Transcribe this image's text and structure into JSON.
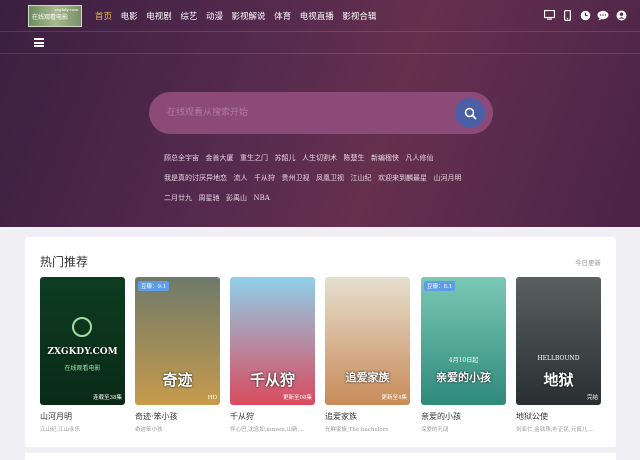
{
  "logo": {
    "text": "在线观看电影",
    "small": "zxgkdy.com"
  },
  "nav": [
    {
      "label": "首页",
      "active": true
    },
    {
      "label": "电影"
    },
    {
      "label": "电视剧"
    },
    {
      "label": "综艺"
    },
    {
      "label": "动漫"
    },
    {
      "label": "影视解说"
    },
    {
      "label": "体育"
    },
    {
      "label": "电视直播"
    },
    {
      "label": "影视合辑"
    }
  ],
  "top_icons": [
    "desktop-icon",
    "mobile-icon",
    "history-icon",
    "chat-icon",
    "user-icon"
  ],
  "search": {
    "placeholder": "在线观看从搜索开始"
  },
  "hot_tags": [
    "顾总全宇宙",
    "金善大厦",
    "重生之门",
    "苏韶儿",
    "人生切割术",
    "陈楚生",
    "新编楹侠",
    "凡人修仙",
    "我是真的讨厌异地恋",
    "流人",
    "千从狩",
    "贵州卫视",
    "凤凰卫视",
    "江山纪",
    "欢迎来到麟最星",
    "山河月明",
    "二月廿九",
    "周星驰",
    "彭禹山",
    "NBA"
  ],
  "section": {
    "title": "热门推荐",
    "more": "今日更新",
    "cards": [
      {
        "title": "山河月明",
        "sub": "江山纪,江山永乐",
        "badge": "",
        "note": "连载至38集",
        "colors": [
          "#0d3d20",
          "#0a2a18"
        ],
        "poster_text": "ZXGKDY.COM",
        "poster_sub": "在线观看电影"
      },
      {
        "title": "奇迹·笨小孩",
        "sub": "奇迹笨小孩",
        "badge": "豆瓣：9.1",
        "note": "HD",
        "colors": [
          "#6e7a6a",
          "#c79b4c"
        ],
        "poster_text": "奇迹",
        "poster_sub": ""
      },
      {
        "title": "千从狩",
        "sub": "怦心巴,沈念如,kinsen,山新,...",
        "badge": "",
        "note": "更新至08集",
        "colors": [
          "#8fd0ea",
          "#d94a5e"
        ],
        "poster_text": "千从狩",
        "poster_sub": ""
      },
      {
        "title": "追爱家族",
        "sub": "光鲜家族,The bachelors",
        "badge": "",
        "note": "更新至4集",
        "colors": [
          "#e5dfcf",
          "#c98b58"
        ],
        "poster_text": "追爱家族",
        "poster_sub": ""
      },
      {
        "title": "亲爱的小孩",
        "sub": "深爱的孔阔",
        "badge": "豆瓣：8.1",
        "note": "",
        "colors": [
          "#7bc8b5",
          "#2f8a7c"
        ],
        "poster_text": "亲爱的小孩",
        "poster_sub": "4月10日起"
      },
      {
        "title": "地狱公使",
        "sub": "刘亚仁,金铉珠,朴正民,元真儿,...",
        "badge": "",
        "note": "完结",
        "colors": [
          "#59605f",
          "#2a2f31"
        ],
        "poster_text": "地狱",
        "poster_sub": "HELLBOUND"
      }
    ]
  }
}
